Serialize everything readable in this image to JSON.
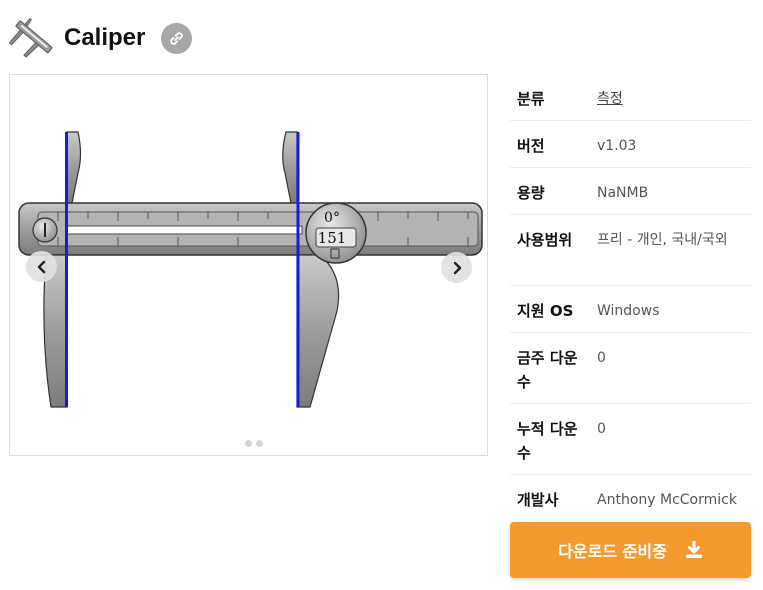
{
  "app": {
    "title": "Caliper",
    "icon": "caliper-icon",
    "link_icon": "link-icon"
  },
  "gallery": {
    "readout_angle": "0°",
    "readout_value": "151",
    "slide_count": 2,
    "active_slide": 1,
    "prev_icon": "chevron-left-icon",
    "next_icon": "chevron-right-icon"
  },
  "info": {
    "rows": [
      {
        "label": "분류",
        "value": "측정",
        "is_link": true
      },
      {
        "label": "버전",
        "value": "v1.03"
      },
      {
        "label": "용량",
        "value": "NaNMB"
      },
      {
        "label": "사용범위",
        "value": "프리 - 개인, 국내/국외"
      },
      {
        "label": "지원 OS",
        "value": "Windows"
      },
      {
        "label": "금주 다운수",
        "value": "0"
      },
      {
        "label": "누적 다운수",
        "value": "0"
      },
      {
        "label": "개발사",
        "value": "Anthony McCormick"
      }
    ]
  },
  "download": {
    "label": "다운로드 준비중",
    "icon": "download-icon"
  },
  "colors": {
    "accent": "#f59a2f",
    "caliper_edge": "#1a1ad8",
    "link_button": "#a7a7a7"
  }
}
